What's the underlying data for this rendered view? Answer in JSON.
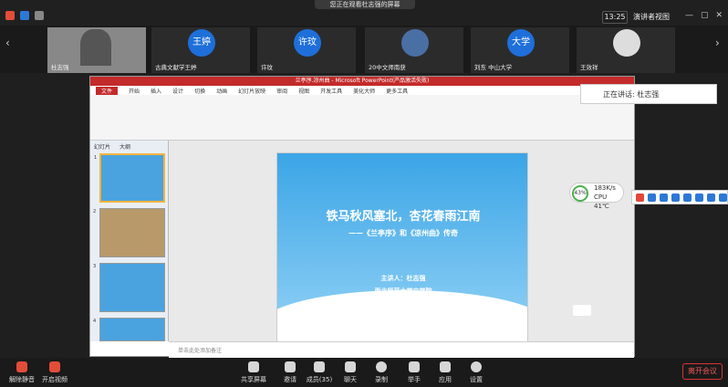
{
  "top": {
    "banner": "您正在观看杜志强的屏幕",
    "time": "13:25",
    "view": "演讲者视图"
  },
  "participants": [
    {
      "name": "杜志强",
      "avatar": ""
    },
    {
      "name": "古典文献学王婷",
      "avatar": "王婷"
    },
    {
      "name": "许玟",
      "avatar": "许玟"
    },
    {
      "name": "20中文师南获",
      "avatar": ""
    },
    {
      "name": "刘东 中山大学",
      "avatar": "大学"
    },
    {
      "name": "王效祥",
      "avatar": ""
    }
  ],
  "ppt": {
    "window_title": "兰亭序.凉州曲 - Microsoft PowerPoint(产品激活失败)",
    "menus": [
      "文件",
      "开始",
      "插入",
      "设计",
      "切换",
      "动画",
      "幻灯片放映",
      "审阅",
      "视图",
      "开发工具",
      "美化大师",
      "更多工具"
    ],
    "thumbs_tabs": [
      "幻灯片",
      "大纲"
    ],
    "slide_numbers": [
      "1",
      "2",
      "3",
      "4"
    ],
    "slide": {
      "title": "铁马秋风塞北，杏花春雨江南",
      "subtitle": "——《兰亭序》和《凉州曲》传奇",
      "speaker": "主讲人：杜志强",
      "affiliation": "西北师范大学文学院"
    },
    "notes_placeholder": "单击此处添加备注"
  },
  "side_label": "正在讲话: 杜志强",
  "cpu": {
    "percent": "43%",
    "line1": "183K/s",
    "line2": "CPU 41℃"
  },
  "bottom": {
    "unmute": "解除静音",
    "video": "开启视频",
    "share": "共享屏幕",
    "invite": "邀请",
    "members": "成员(35)",
    "chat": "聊天",
    "record": "录制",
    "hand": "举手",
    "apps": "应用",
    "settings": "设置",
    "leave": "离开会议"
  },
  "colors": {
    "accent": "#c32b2b",
    "slide_blue": "#3ba5e6",
    "leave": "#e55555"
  }
}
